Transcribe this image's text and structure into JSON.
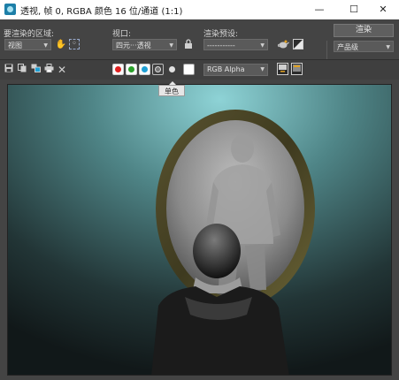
{
  "window": {
    "title": "透视, 帧 0, RGBA 颜色 16 位/通道 (1:1)",
    "minimize_glyph": "—",
    "maximize_glyph": "☐",
    "close_glyph": "✕"
  },
  "render_setup": {
    "area_label": "要渲染的区域:",
    "area_value": "视图",
    "viewport_label": "视口:",
    "viewport_value": "四元···透视",
    "preset_label": "渲染预设:",
    "preset_value": "-----------",
    "render_button": "渲染",
    "quality_value": "产品级"
  },
  "channel_toolbar": {
    "channel_select": "RGB Alpha",
    "tooltip": "单色"
  },
  "colors": {
    "red_channel": "#e02020",
    "green_channel": "#2aa02a",
    "blue_channel": "#1e9fd4",
    "accent_icon": "#e0a020"
  },
  "icons": {
    "save": "save-icon",
    "copy": "copy-icon",
    "clone": "clone-window-icon",
    "print": "print-icon",
    "clear": "clear-icon",
    "lock": "lock-icon",
    "lighting": "teapot-icon",
    "environment": "environment-icon",
    "display_toggle": "display-toggle-icon",
    "history": "history-icon"
  }
}
